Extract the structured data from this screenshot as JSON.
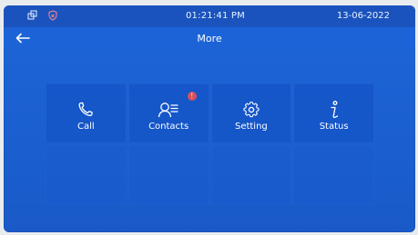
{
  "status_bar": {
    "left_icons": [
      "network-icon",
      "shield-icon"
    ],
    "time": "01:21:41   PM",
    "date": "13-06-2022"
  },
  "title_bar": {
    "back_icon": "arrow-left-icon",
    "title": "More"
  },
  "menu": {
    "tiles": [
      {
        "label": "Call",
        "icon": "phone-icon"
      },
      {
        "label": "Contacts",
        "icon": "contacts-icon"
      },
      {
        "label": "Setting",
        "icon": "gear-icon"
      },
      {
        "label": "Status",
        "icon": "info-icon"
      }
    ]
  },
  "colors": {
    "background": "#1e66d8",
    "status_bar": "#1a53bd",
    "title_bar": "#1c63d7",
    "tile": "#1455c8",
    "text": "#ffffff",
    "badge": "#d6505b"
  }
}
